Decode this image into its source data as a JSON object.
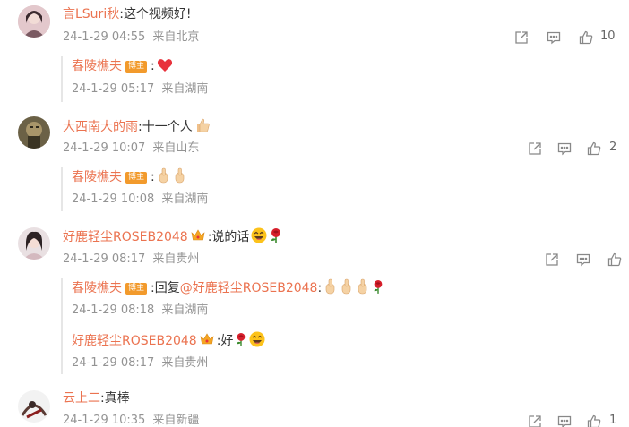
{
  "comments": [
    {
      "user": "言LSuri秋",
      "text": "这个视频好!",
      "date": "24-1-29 04:55",
      "location": "来自北京",
      "likes": "10",
      "replies": [
        {
          "user": "春陵樵夫",
          "badge": "博主",
          "text": ":",
          "date": "24-1-29 05:17",
          "location": "来自湖南"
        }
      ]
    },
    {
      "user": "大西南大的雨",
      "text": "十一个人",
      "date": "24-1-29 10:07",
      "location": "来自山东",
      "likes": "2",
      "replies": [
        {
          "user": "春陵樵夫",
          "badge": "博主",
          "text": ":",
          "date": "24-1-29 10:08",
          "location": "来自湖南"
        }
      ]
    },
    {
      "user": "好鹿轻尘ROSEB2048",
      "text": ":说的话",
      "date": "24-1-29 08:17",
      "location": "来自贵州",
      "likes": "",
      "replies": [
        {
          "user": "春陵樵夫",
          "badge": "博主",
          "prefix": ":回复",
          "mention": "@好鹿轻尘ROSEB2048",
          "text": ":",
          "date": "24-1-29 08:18",
          "location": "来自湖南"
        },
        {
          "user": "好鹿轻尘ROSEB2048",
          "text": ":好",
          "date": "24-1-29 08:17",
          "location": "来自贵州"
        }
      ]
    },
    {
      "user": "云上二",
      "text": "真棒",
      "date": "24-1-29 10:35",
      "location": "来自新疆",
      "likes": "1",
      "replies": []
    }
  ],
  "colors": {
    "name": "#eb7350",
    "meta": "#939393",
    "badge": "#f29a2c"
  }
}
